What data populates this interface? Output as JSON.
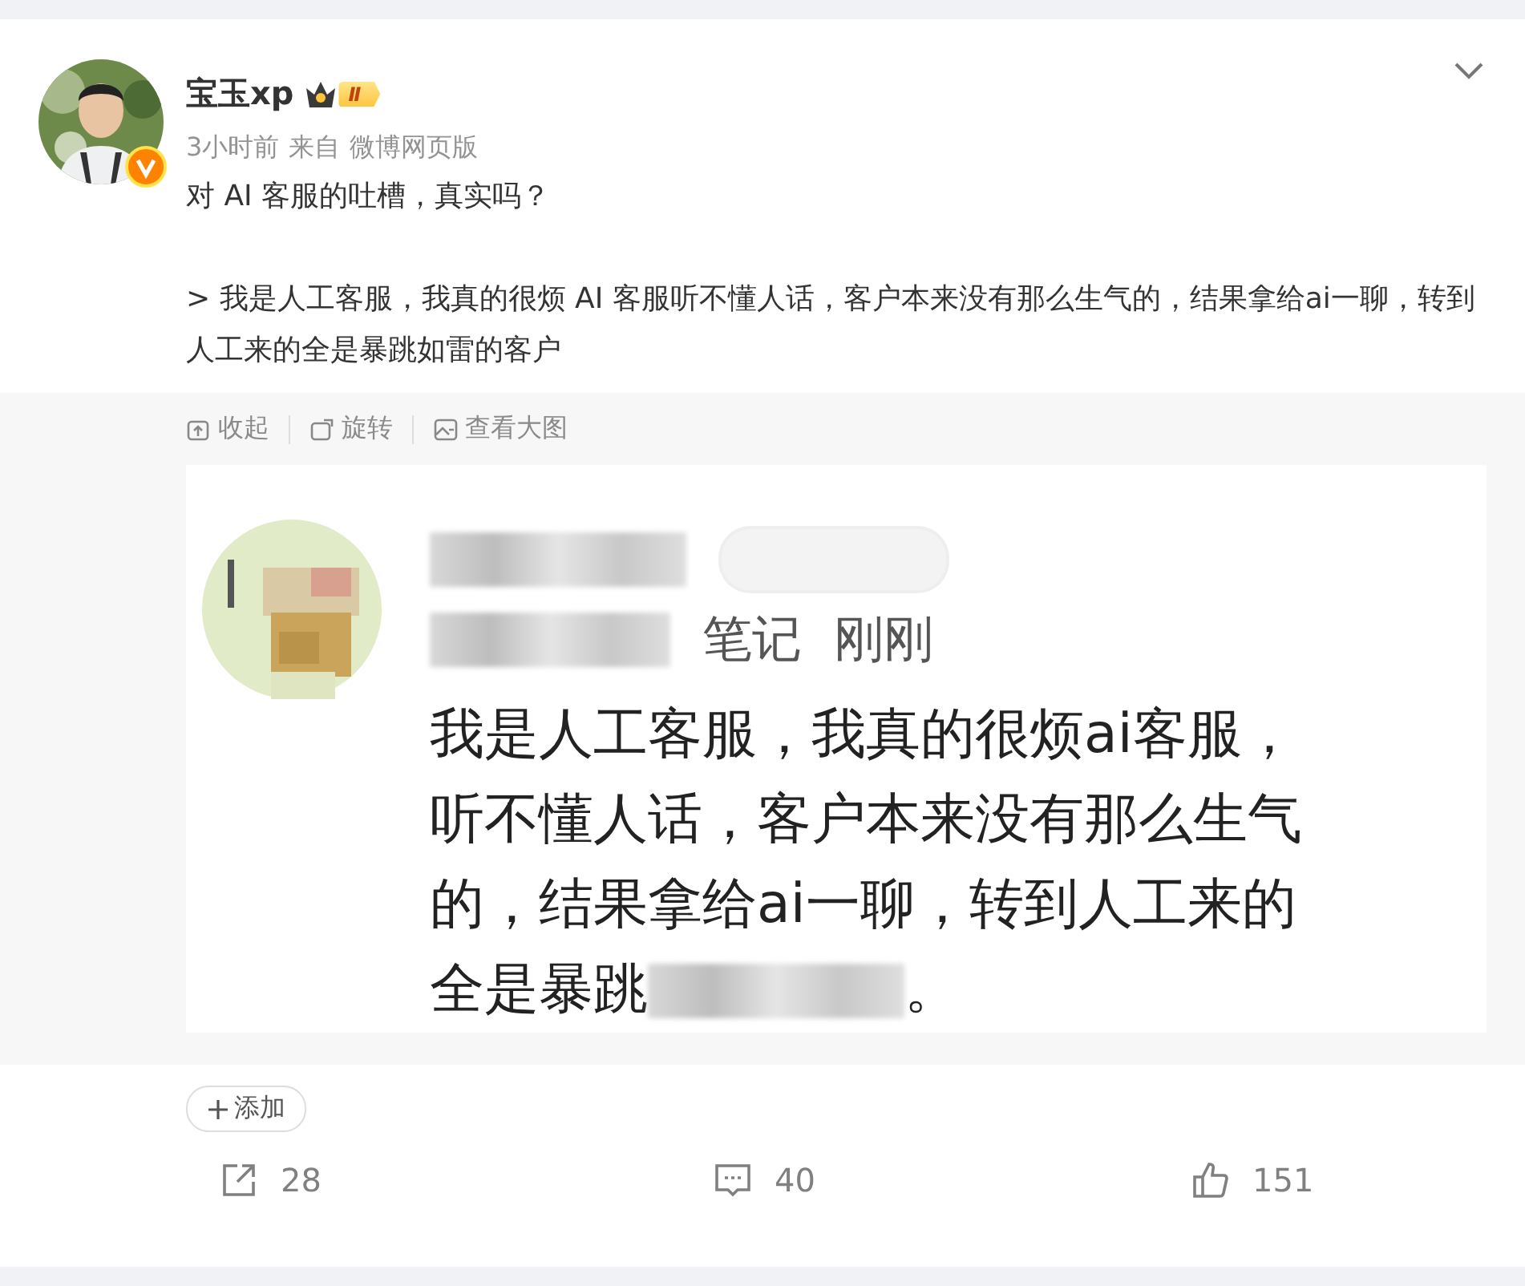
{
  "post": {
    "author": {
      "name": "宝玉xp",
      "level_badge": "Ⅱ",
      "verified": true
    },
    "meta": {
      "time": "3小时前",
      "source_prefix": "来自",
      "source": "微博网页版"
    },
    "paragraphs": [
      "对 AI 客服的吐槽，真实吗？",
      "> 我是人工客服，我真的很烦 AI 客服听不懂人话，客户本来没有那么生气的，结果拿给ai一聊，转到人工来的全是暴跳如雷的客户"
    ]
  },
  "image_toolbar": [
    {
      "kind": "collapse",
      "label": "收起"
    },
    {
      "kind": "rotate",
      "label": "旋转"
    },
    {
      "kind": "enlarge",
      "label": "查看大图"
    }
  ],
  "embedded_screenshot": {
    "subtitle_visible": "笔记",
    "time": "刚刚",
    "lines": [
      "我是人工客服，我真的很烦ai客服，",
      "听不懂人话，客户本来没有那么生气",
      "的，结果拿给ai一聊，转到人工来的"
    ],
    "last_line_start": "全是暴跳",
    "last_line_end": "。"
  },
  "tag_button": {
    "label": "添加"
  },
  "actions": [
    {
      "kind": "share",
      "count": "28"
    },
    {
      "kind": "comment",
      "count": "40"
    },
    {
      "kind": "like",
      "count": "151"
    }
  ]
}
